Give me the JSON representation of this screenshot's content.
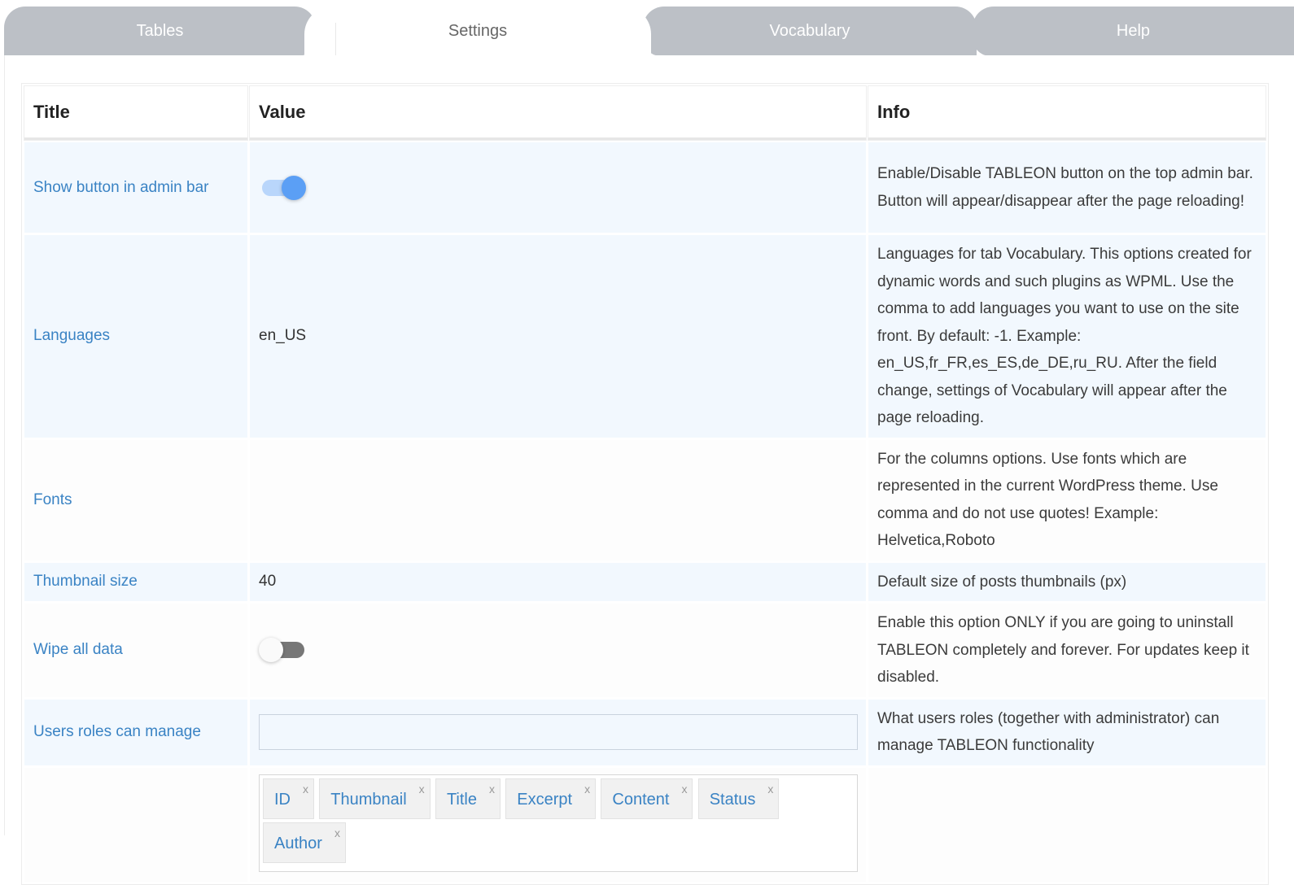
{
  "tabs": [
    {
      "label": "Tables"
    },
    {
      "label": "Settings"
    },
    {
      "label": "Vocabulary"
    },
    {
      "label": "Help"
    }
  ],
  "table": {
    "headers": {
      "title": "Title",
      "value": "Value",
      "info": "Info"
    },
    "rows": {
      "admin_bar": {
        "title": "Show button in admin bar",
        "toggle": "on",
        "info": "Enable/Disable TABLEON button on the top admin bar. Button will appear/disappear after the page reloading!"
      },
      "languages": {
        "title": "Languages",
        "value": "en_US",
        "info": "Languages for tab Vocabulary. This options created for dynamic words and such plugins as WPML. Use the comma to add languages you want to use on the site front. By default: -1. Example: en_US,fr_FR,es_ES,de_DE,ru_RU. After the field change, settings of Vocabulary will appear after the page reloading."
      },
      "fonts": {
        "title": "Fonts",
        "value": "",
        "info": "For the columns options. Use fonts which are represented in the current WordPress theme. Use comma and do not use quotes! Example: Helvetica,Roboto"
      },
      "thumbnail": {
        "title": "Thumbnail size",
        "value": "40",
        "info": "Default size of posts thumbnails (px)"
      },
      "wipe": {
        "title": "Wipe all data",
        "toggle": "off",
        "info": "Enable this option ONLY if you are going to uninstall TABLEON completely and forever. For updates keep it disabled."
      },
      "roles": {
        "title": "Users roles can manage",
        "value": "",
        "info": "What users roles (together with administrator) can manage TABLEON functionality"
      },
      "columns": {
        "chips": [
          "ID",
          "Thumbnail",
          "Title",
          "Excerpt",
          "Content",
          "Status",
          "Author"
        ],
        "remove_symbol": "x"
      }
    }
  },
  "colors": {
    "tab_inactive": "#bcc0c6",
    "link_blue": "#3a83c4",
    "row_alt": "#f2f8fe",
    "toggle_on": "#5b9ff5"
  }
}
